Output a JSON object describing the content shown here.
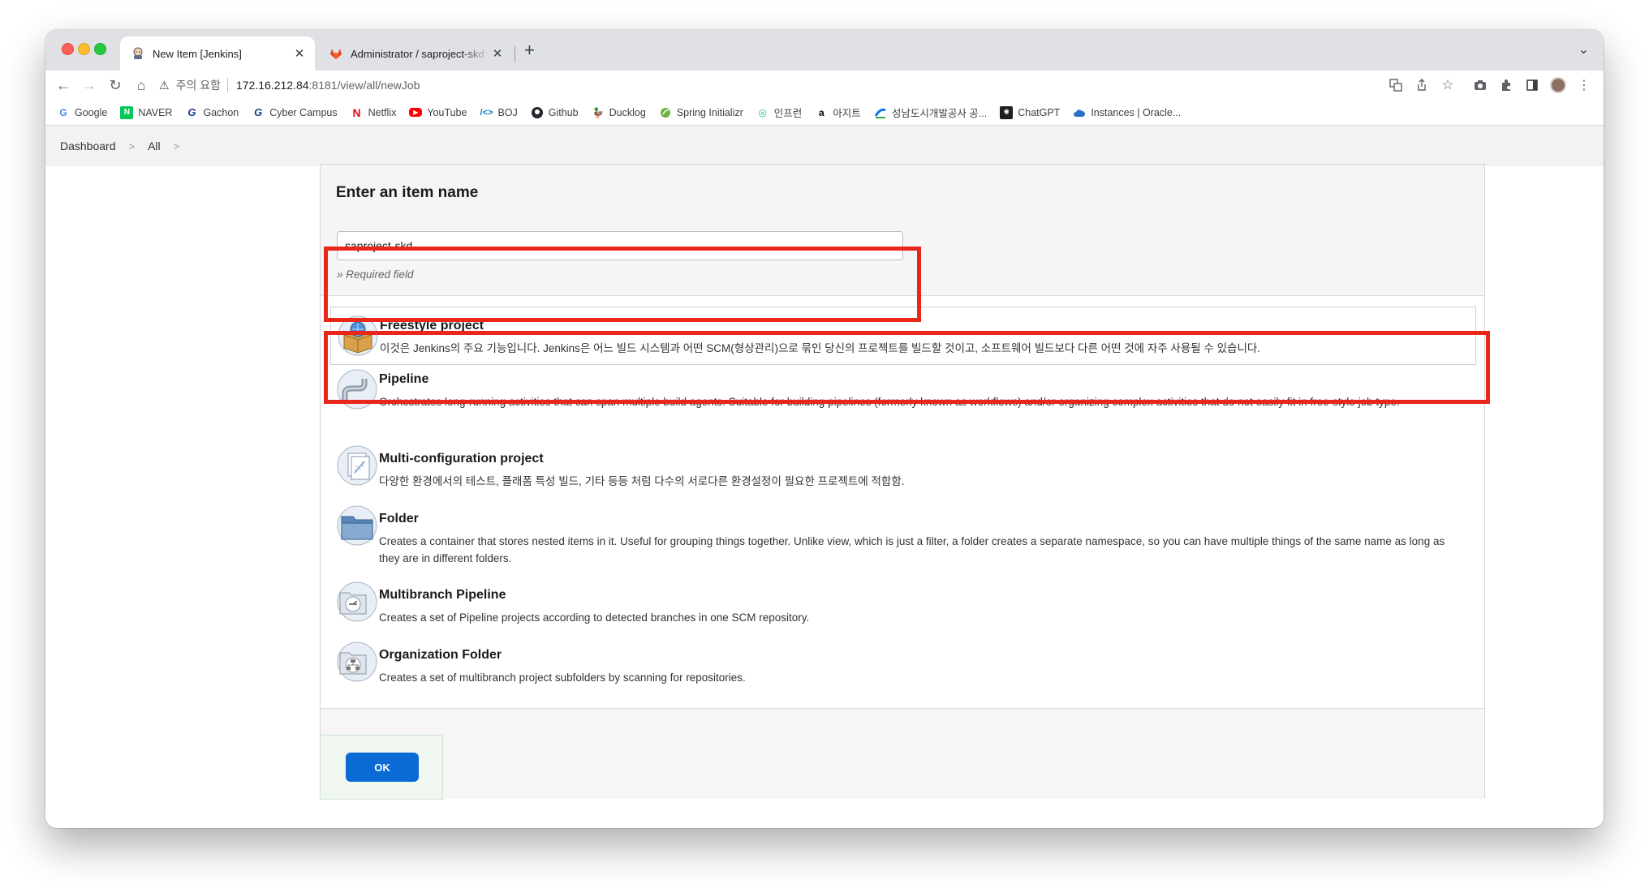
{
  "browser": {
    "tabs": [
      {
        "title": "New Item [Jenkins]",
        "active": true
      },
      {
        "title": "Administrator / saproject-skd · GitLab",
        "active": false
      }
    ],
    "address": {
      "warning": "주의 요함",
      "host": "172.16.212.84",
      "path": ":8181/view/all/newJob"
    },
    "bookmarks": [
      {
        "label": "Google",
        "icon": "google-icon"
      },
      {
        "label": "NAVER",
        "icon": "naver-icon"
      },
      {
        "label": "Gachon",
        "icon": "gachon-icon"
      },
      {
        "label": "Cyber Campus",
        "icon": "gachon-icon"
      },
      {
        "label": "Netflix",
        "icon": "netflix-icon"
      },
      {
        "label": "YouTube",
        "icon": "youtube-icon"
      },
      {
        "label": "BOJ",
        "icon": "boj-icon"
      },
      {
        "label": "Github",
        "icon": "github-icon"
      },
      {
        "label": "Ducklog",
        "icon": "ducklog-icon"
      },
      {
        "label": "Spring Initializr",
        "icon": "spring-icon"
      },
      {
        "label": "인프런",
        "icon": "inflearn-icon"
      },
      {
        "label": "아지트",
        "icon": "agit-icon"
      },
      {
        "label": "성남도시개발공사 공...",
        "icon": "snhouse-icon"
      },
      {
        "label": "ChatGPT",
        "icon": "chatgpt-icon"
      },
      {
        "label": "Instances | Oracle...",
        "icon": "cloud-icon"
      }
    ]
  },
  "breadcrumb": {
    "items": [
      "Dashboard",
      "All"
    ]
  },
  "form": {
    "title": "Enter an item name",
    "item_name": "saproject-skd",
    "required_hint": "» Required field",
    "ok_label": "OK"
  },
  "item_types": [
    {
      "name": "Freestyle project",
      "description": "이것은 Jenkins의 주요 기능입니다. Jenkins은 어느 빌드 시스템과 어떤 SCM(형상관리)으로 묶인 당신의 프로젝트를 빌드할 것이고, 소프트웨어 빌드보다 다른 어떤 것에 자주 사용될 수 있습니다.",
      "icon": "freestyle-project-icon",
      "selected": true
    },
    {
      "name": "Pipeline",
      "description": "Orchestrates long-running activities that can span multiple build agents. Suitable for building pipelines (formerly known as workflows) and/or organizing complex activities that do not easily fit in free-style job type.",
      "icon": "pipeline-icon",
      "selected": false
    },
    {
      "name": "Multi-configuration project",
      "description": "다양한 환경에서의 테스트, 플래폼 특성 빌드, 기타 등등 처럼 다수의 서로다른 환경설정이 필요한 프로젝트에 적합함.",
      "icon": "multi-configuration-icon",
      "selected": false
    },
    {
      "name": "Folder",
      "description": "Creates a container that stores nested items in it. Useful for grouping things together. Unlike view, which is just a filter, a folder creates a separate namespace, so you can have multiple things of the same name as long as they are in different folders.",
      "icon": "folder-icon",
      "selected": false
    },
    {
      "name": "Multibranch Pipeline",
      "description": "Creates a set of Pipeline projects according to detected branches in one SCM repository.",
      "icon": "multibranch-pipeline-icon",
      "selected": false
    },
    {
      "name": "Organization Folder",
      "description": "Creates a set of multibranch project subfolders by scanning for repositories.",
      "icon": "organization-folder-icon",
      "selected": false
    }
  ],
  "colors": {
    "highlight": "#e8261a",
    "ok_button": "#0b6ad4"
  }
}
